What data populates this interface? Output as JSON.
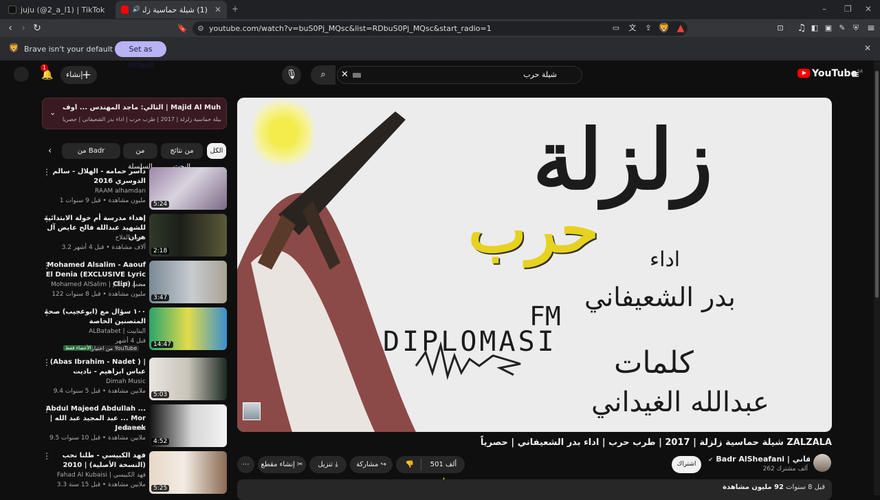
{
  "browser": {
    "tabs": [
      {
        "title": "juju (@2_a_l1) | TikTok"
      },
      {
        "title": "(1) شيلة حماسية زلزلة | 2017 |"
      }
    ],
    "url": "youtube.com/watch?v=buS0Pj_MQsc&list=RDbuS0Pj_MQsc&start_radio=1",
    "infobar": {
      "message": "Brave isn't your default browser",
      "button": "Set as default"
    }
  },
  "youtube": {
    "logo": "YouTube",
    "logo_region": "SA",
    "search_value": "شيلة حرب",
    "create_label": "إنشاء",
    "notif_count": "1",
    "playlist": {
      "now_playing": "التالي: ماجد المهندس ... أوف | Majid Al Muhandis ... Off",
      "mix_title": "ميكس شيلة حماسية زلزلة | 2017 | طرب حرب | اداء بدر الشعيفاني | حصرياً LA..."
    },
    "chips": [
      "الكل",
      "من نتائج البحث",
      "من السلسلة",
      "من Badr AlSheafani"
    ],
    "recommendations": [
      {
        "title": "داسر حمامه - الهلال - سالم الدوسري 2016",
        "channel": "RAAM alhamdan",
        "meta": "1 مليون مشاهدة • قبل 9 سنوات",
        "duration": "5:24"
      },
      {
        "title": "إهداء مدرسة أم خولة الابتدائية للشهيد عبدالله فالح عايض آل هران",
        "channel": "محمد الفلاح",
        "meta": "3.2 آلاف مشاهدة • قبل 4 أشهر",
        "duration": "2:18"
      },
      {
        "title": "Mohamed Alsalim - Aaouf El Denia (EXCLUSIVE Lyric Clip) | ...",
        "channel": "Mohamed AlSalim | محمد السالم",
        "meta": "122 مليون مشاهدة • قبل 8 سنوات",
        "duration": "3:47"
      },
      {
        "title": "١٠٠ سؤال مع (ابوعجيب) صحة المتصنين الخاصة",
        "channel": "ALBatabet | البتابيت",
        "meta": "قبل 4 أشهر",
        "duration": "14:47",
        "badge": "من اختيار YouTube",
        "badge2": "الأعضاء فقط"
      },
      {
        "title": "(Abas Ibrahim - Nadet ) | عباس ابراهيم - ناديت",
        "channel": "Dimah Music",
        "meta": "9.4 ملايين مشاهدة • قبل 5 سنوات",
        "duration": "5:03"
      },
      {
        "title": "Abdul Majeed Abdullah ... | عبد المجيد عبد الله ... Mor Jedaeek",
        "channel": "Rotana",
        "meta": "9.5 ملايين مشاهدة • قبل 10 سنوات",
        "duration": "4:52"
      },
      {
        "title": "فهد الكبيسي - طلنا نحب (النسخة الأصلية) | 2010",
        "channel": "Fahad Al Kubaisi | فهد الكبيسي",
        "meta": "3.3 ملايين مشاهدة • قبل 15 سنة",
        "duration": "5:25"
      }
    ],
    "video": {
      "title": "شيلة حماسية زلزلة | 2017 | طرب حرب | اداء بدر الشعيفاني | حصرياً ZALZALA",
      "art_title": "زلزلة",
      "art_sub": "حرب",
      "art_perf_label": "اداء",
      "art_perf_name": "بدر الشعيفاني",
      "art_fm": "FM",
      "art_brand": "DIPLOMASI",
      "art_lyrics_label": "كلمات",
      "art_lyrics_name": "عبدالله الغيداني",
      "channel": "Badr AlSheafani | بدر الشعيفاني",
      "subscribers": "262 ألف مشترك",
      "subscribe_label": "اشتراك",
      "likes": "501 ألف",
      "share_label": "مشاركة",
      "download_label": "تنزيل",
      "clip_label": "إنشاء مقطع",
      "views": "92 مليون مشاهدة",
      "age": "قبل 8 سنوات"
    }
  }
}
